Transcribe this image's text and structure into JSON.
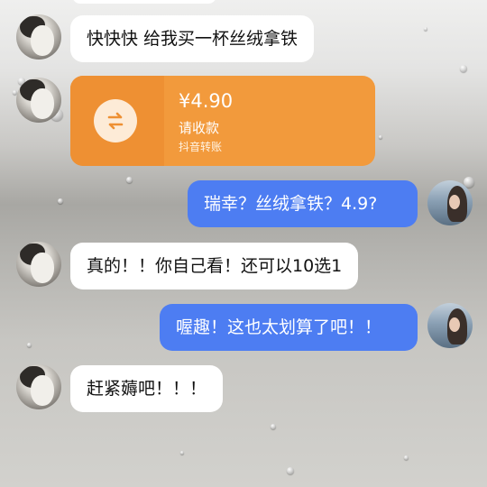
{
  "theme": {
    "incoming_bubble_color": "#ffffff",
    "outgoing_bubble_color": "#4d7df2",
    "transfer_card_color": "#f29a3c"
  },
  "messages": [
    {
      "sender": "friend",
      "type": "text",
      "text": "快快快 给我买一杯丝绒拿铁"
    },
    {
      "sender": "friend",
      "type": "transfer",
      "amount": "¥4.90",
      "status": "请收款",
      "source": "抖音转账",
      "icon": "exchange-arrows-icon"
    },
    {
      "sender": "me",
      "type": "text",
      "text": "瑞幸？丝绒拿铁？4.9?"
    },
    {
      "sender": "friend",
      "type": "text",
      "text": "真的！！你自己看！还可以10选1"
    },
    {
      "sender": "me",
      "type": "text",
      "text": "喔趣！这也太划算了吧！！"
    },
    {
      "sender": "friend",
      "type": "text",
      "text": "赶紧薅吧！！！"
    }
  ]
}
